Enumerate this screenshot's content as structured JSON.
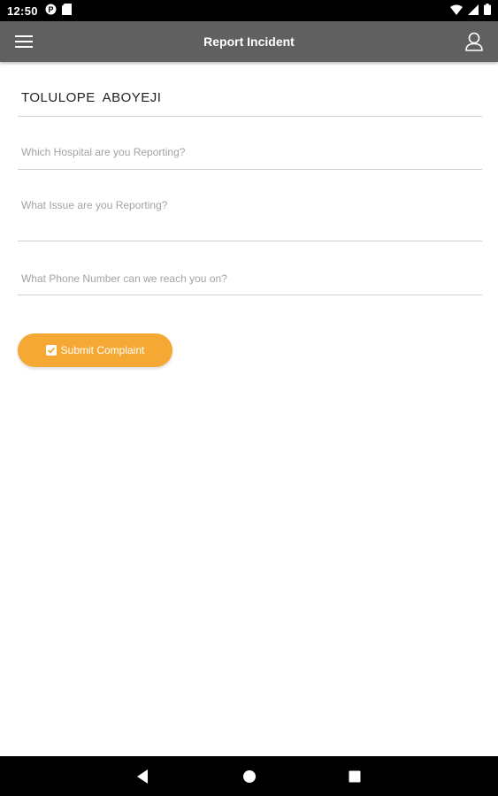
{
  "status_bar": {
    "time": "12:50",
    "left_icons": [
      "notification-p-icon",
      "sd-card-icon"
    ],
    "right_icons": [
      "wifi-icon",
      "signal-icon",
      "battery-icon"
    ]
  },
  "app_bar": {
    "title": "Report Incident",
    "menu_icon": "hamburger-menu-icon",
    "profile_icon": "user-profile-icon",
    "background": "#606060"
  },
  "form": {
    "name_value": "TOLULOPE  ABOYEJI",
    "hospital_placeholder": "Which Hospital are you Reporting?",
    "issue_placeholder": "What Issue are you Reporting?",
    "phone_placeholder": "What Phone Number can we reach you on?"
  },
  "submit": {
    "label": "Submit Complaint",
    "icon": "checkbox-checked-icon",
    "color": "#f5a833"
  },
  "nav_bar": {
    "icons": [
      "back-triangle-icon",
      "home-circle-icon",
      "recents-square-icon"
    ]
  }
}
